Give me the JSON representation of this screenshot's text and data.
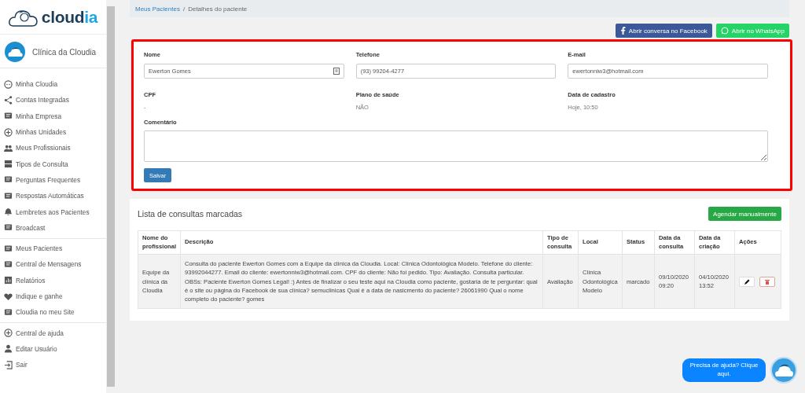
{
  "brand": {
    "name_start": "cloud",
    "name_end": "ia"
  },
  "clinic": {
    "name": "Clínica da Cloudia"
  },
  "sidebar": {
    "groups": [
      [
        {
          "label": "Minha Cloudia",
          "selected": false
        },
        {
          "label": "Contas Integradas",
          "selected": false
        },
        {
          "label": "Minha Empresa",
          "selected": false
        },
        {
          "label": "Minhas Unidades",
          "selected": false
        },
        {
          "label": "Meus Profissionais",
          "selected": false
        },
        {
          "label": "Tipos de Consulta",
          "selected": false
        },
        {
          "label": "Perguntas Frequentes",
          "selected": false
        },
        {
          "label": "Respostas Automáticas",
          "selected": false
        },
        {
          "label": "Lembretes aos Pacientes",
          "selected": false
        },
        {
          "label": "Broadcast",
          "selected": false
        }
      ],
      [
        {
          "label": "Meus Pacientes",
          "selected": false
        },
        {
          "label": "Central de Mensagens",
          "selected": false
        },
        {
          "label": "Relatórios",
          "selected": false
        },
        {
          "label": "Indique e ganhe",
          "selected": false
        },
        {
          "label": "Cloudia no meu Site",
          "selected": false
        }
      ],
      [
        {
          "label": "Central de ajuda",
          "selected": false
        },
        {
          "label": "Editar Usuário",
          "selected": false
        },
        {
          "label": "Sair",
          "selected": false
        }
      ]
    ]
  },
  "breadcrumb": [
    {
      "label": "Meus Pacientes",
      "kind": "link"
    },
    {
      "label": "Detalhes do paciente",
      "kind": "current"
    }
  ],
  "breadcrumb_separator": "/",
  "actions": [
    {
      "label": "Abrir conversa no Facebook",
      "kind": "facebook"
    },
    {
      "label": "Abrir no WhatsApp",
      "kind": "whatsapp"
    }
  ],
  "patient": {
    "fields": [
      {
        "label": "Nome",
        "value": "Ewerton Gomes",
        "kind": "input"
      },
      {
        "label": "Telefone",
        "value": "(93) 99204-4277",
        "kind": "input"
      },
      {
        "label": "E-mail",
        "value": "ewertonniw3@hotmail.com",
        "kind": "input"
      },
      {
        "label": "CPF",
        "value": "-",
        "kind": "text"
      },
      {
        "label": "Plano de saúde",
        "value": "NÃO",
        "kind": "text"
      },
      {
        "label": "Data de cadastro",
        "value": "Hoje, 10:50",
        "kind": "text"
      }
    ],
    "comment_label": "Comentário",
    "save_button": "Salvar"
  },
  "appointments": {
    "title": "Lista de consultas marcadas",
    "add_button": "Agendar manualmente",
    "columns": [
      "Nome do profissional",
      "Descrição",
      "Tipo de consulta",
      "Local",
      "Status",
      "Data da consulta",
      "Data da criação",
      "Ações"
    ],
    "rows": [
      {
        "professional": "Equipe da clínica da Cloudia",
        "description": "Consulta do paciente Ewerton Gomes com a Equipe da clínica da Cloudia. Local: Clínica Odontológica Modelo. Telefone do cliente: 93992044277. Email do cliente: ewertonniw3@hotmail.com. CPF do cliente: Não foi pedido. Tipo: Avaliação. Consulta particular. OBSs: Paciente Ewerton Gomes Legal! :) Antes de finalizar o seu teste aqui na Cloudia como paciente, gostaria de te perguntar: qual é o site ou página do Facebook de sua clínica? semuclinicas Qual é a data de nasicmento do paciente? 26061990 Qual o nome completo do paciente? gomes",
        "type": "Avaliação",
        "place": "Clínica Odontológica Modelo",
        "status": "marcado",
        "date": "09/10/2020 09:20",
        "created": "04/10/2020 13:52"
      }
    ]
  },
  "help": {
    "label": "Precisa de ajuda? Clique aqui."
  }
}
